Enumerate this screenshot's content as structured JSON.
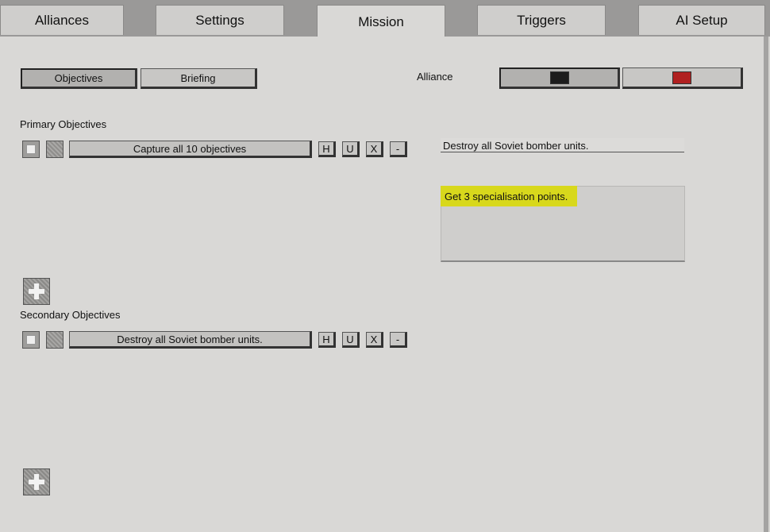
{
  "tabs": [
    {
      "label": "Alliances"
    },
    {
      "label": "Settings"
    },
    {
      "label": "Mission"
    },
    {
      "label": "Triggers"
    },
    {
      "label": "AI Setup"
    }
  ],
  "subtabs": {
    "objectives": "Objectives",
    "briefing": "Briefing"
  },
  "alliance": {
    "label": "Alliance",
    "colors": [
      "#1c1c1c",
      "#b02020"
    ]
  },
  "primary": {
    "title": "Primary Objectives",
    "items": [
      {
        "text": "Capture all 10 objectives"
      }
    ]
  },
  "secondary": {
    "title": "Secondary Objectives",
    "items": [
      {
        "text": "Destroy all Soviet bomber units."
      }
    ]
  },
  "row_buttons": {
    "h": "H",
    "u": "U",
    "x": "X",
    "minus": "-"
  },
  "description_field": "Destroy all Soviet bomber units.",
  "briefing_text": "Get 3 specialisation points."
}
